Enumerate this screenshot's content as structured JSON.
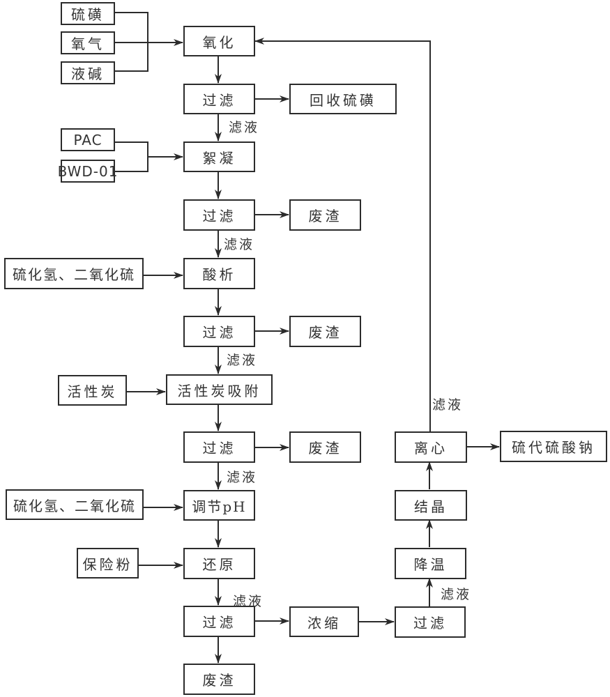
{
  "diagram": {
    "type": "process-flowchart",
    "colors": {
      "line": "#2b2b2b",
      "text": "#333333",
      "background": "#ffffff"
    },
    "nodes": {
      "sulfur": "硫磺",
      "oxygen": "氧气",
      "liquid_alkali": "液碱",
      "oxidation": "氧化",
      "filter1": "过滤",
      "recover_sulfur": "回收硫磺",
      "pac": "PAC",
      "bwd01": "BWD-01",
      "flocculation": "絮凝",
      "filter2": "过滤",
      "waste1": "废渣",
      "acid_gas1": "硫化氢、二氧化硫",
      "acidification": "酸析",
      "filter3": "过滤",
      "waste2": "废渣",
      "activated_carbon": "活性炭",
      "carbon_adsorption": "活性炭吸附",
      "filter4": "过滤",
      "waste3": "废渣",
      "acid_gas2": "硫化氢、二氧化硫",
      "adjust_ph": "调节pH",
      "sodium_hydrosulfite": "保险粉",
      "reduction": "还原",
      "filter5": "过滤",
      "waste4": "废渣",
      "concentration": "浓缩",
      "filter6": "过滤",
      "cooling": "降温",
      "crystallization": "结晶",
      "centrifuge": "离心",
      "sodium_thiosulfate": "硫代硫酸钠"
    },
    "edge_labels": {
      "filtrate1": "滤液",
      "filtrate2": "滤液",
      "filtrate3": "滤液",
      "filtrate4": "滤液",
      "filtrate5": "滤液",
      "filtrate6": "滤液",
      "filtrate7": "滤液"
    }
  }
}
